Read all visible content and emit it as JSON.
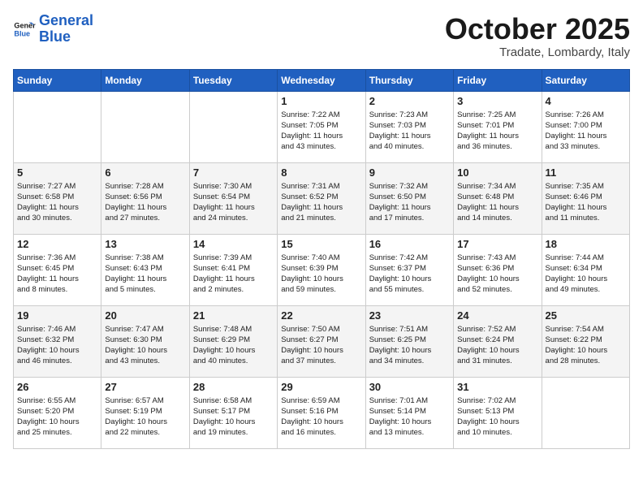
{
  "logo": {
    "line1": "General",
    "line2": "Blue"
  },
  "title": "October 2025",
  "subtitle": "Tradate, Lombardy, Italy",
  "days_of_week": [
    "Sunday",
    "Monday",
    "Tuesday",
    "Wednesday",
    "Thursday",
    "Friday",
    "Saturday"
  ],
  "weeks": [
    [
      {
        "day": "",
        "info": ""
      },
      {
        "day": "",
        "info": ""
      },
      {
        "day": "",
        "info": ""
      },
      {
        "day": "1",
        "info": "Sunrise: 7:22 AM\nSunset: 7:05 PM\nDaylight: 11 hours\nand 43 minutes."
      },
      {
        "day": "2",
        "info": "Sunrise: 7:23 AM\nSunset: 7:03 PM\nDaylight: 11 hours\nand 40 minutes."
      },
      {
        "day": "3",
        "info": "Sunrise: 7:25 AM\nSunset: 7:01 PM\nDaylight: 11 hours\nand 36 minutes."
      },
      {
        "day": "4",
        "info": "Sunrise: 7:26 AM\nSunset: 7:00 PM\nDaylight: 11 hours\nand 33 minutes."
      }
    ],
    [
      {
        "day": "5",
        "info": "Sunrise: 7:27 AM\nSunset: 6:58 PM\nDaylight: 11 hours\nand 30 minutes."
      },
      {
        "day": "6",
        "info": "Sunrise: 7:28 AM\nSunset: 6:56 PM\nDaylight: 11 hours\nand 27 minutes."
      },
      {
        "day": "7",
        "info": "Sunrise: 7:30 AM\nSunset: 6:54 PM\nDaylight: 11 hours\nand 24 minutes."
      },
      {
        "day": "8",
        "info": "Sunrise: 7:31 AM\nSunset: 6:52 PM\nDaylight: 11 hours\nand 21 minutes."
      },
      {
        "day": "9",
        "info": "Sunrise: 7:32 AM\nSunset: 6:50 PM\nDaylight: 11 hours\nand 17 minutes."
      },
      {
        "day": "10",
        "info": "Sunrise: 7:34 AM\nSunset: 6:48 PM\nDaylight: 11 hours\nand 14 minutes."
      },
      {
        "day": "11",
        "info": "Sunrise: 7:35 AM\nSunset: 6:46 PM\nDaylight: 11 hours\nand 11 minutes."
      }
    ],
    [
      {
        "day": "12",
        "info": "Sunrise: 7:36 AM\nSunset: 6:45 PM\nDaylight: 11 hours\nand 8 minutes."
      },
      {
        "day": "13",
        "info": "Sunrise: 7:38 AM\nSunset: 6:43 PM\nDaylight: 11 hours\nand 5 minutes."
      },
      {
        "day": "14",
        "info": "Sunrise: 7:39 AM\nSunset: 6:41 PM\nDaylight: 11 hours\nand 2 minutes."
      },
      {
        "day": "15",
        "info": "Sunrise: 7:40 AM\nSunset: 6:39 PM\nDaylight: 10 hours\nand 59 minutes."
      },
      {
        "day": "16",
        "info": "Sunrise: 7:42 AM\nSunset: 6:37 PM\nDaylight: 10 hours\nand 55 minutes."
      },
      {
        "day": "17",
        "info": "Sunrise: 7:43 AM\nSunset: 6:36 PM\nDaylight: 10 hours\nand 52 minutes."
      },
      {
        "day": "18",
        "info": "Sunrise: 7:44 AM\nSunset: 6:34 PM\nDaylight: 10 hours\nand 49 minutes."
      }
    ],
    [
      {
        "day": "19",
        "info": "Sunrise: 7:46 AM\nSunset: 6:32 PM\nDaylight: 10 hours\nand 46 minutes."
      },
      {
        "day": "20",
        "info": "Sunrise: 7:47 AM\nSunset: 6:30 PM\nDaylight: 10 hours\nand 43 minutes."
      },
      {
        "day": "21",
        "info": "Sunrise: 7:48 AM\nSunset: 6:29 PM\nDaylight: 10 hours\nand 40 minutes."
      },
      {
        "day": "22",
        "info": "Sunrise: 7:50 AM\nSunset: 6:27 PM\nDaylight: 10 hours\nand 37 minutes."
      },
      {
        "day": "23",
        "info": "Sunrise: 7:51 AM\nSunset: 6:25 PM\nDaylight: 10 hours\nand 34 minutes."
      },
      {
        "day": "24",
        "info": "Sunrise: 7:52 AM\nSunset: 6:24 PM\nDaylight: 10 hours\nand 31 minutes."
      },
      {
        "day": "25",
        "info": "Sunrise: 7:54 AM\nSunset: 6:22 PM\nDaylight: 10 hours\nand 28 minutes."
      }
    ],
    [
      {
        "day": "26",
        "info": "Sunrise: 6:55 AM\nSunset: 5:20 PM\nDaylight: 10 hours\nand 25 minutes."
      },
      {
        "day": "27",
        "info": "Sunrise: 6:57 AM\nSunset: 5:19 PM\nDaylight: 10 hours\nand 22 minutes."
      },
      {
        "day": "28",
        "info": "Sunrise: 6:58 AM\nSunset: 5:17 PM\nDaylight: 10 hours\nand 19 minutes."
      },
      {
        "day": "29",
        "info": "Sunrise: 6:59 AM\nSunset: 5:16 PM\nDaylight: 10 hours\nand 16 minutes."
      },
      {
        "day": "30",
        "info": "Sunrise: 7:01 AM\nSunset: 5:14 PM\nDaylight: 10 hours\nand 13 minutes."
      },
      {
        "day": "31",
        "info": "Sunrise: 7:02 AM\nSunset: 5:13 PM\nDaylight: 10 hours\nand 10 minutes."
      },
      {
        "day": "",
        "info": ""
      }
    ]
  ]
}
